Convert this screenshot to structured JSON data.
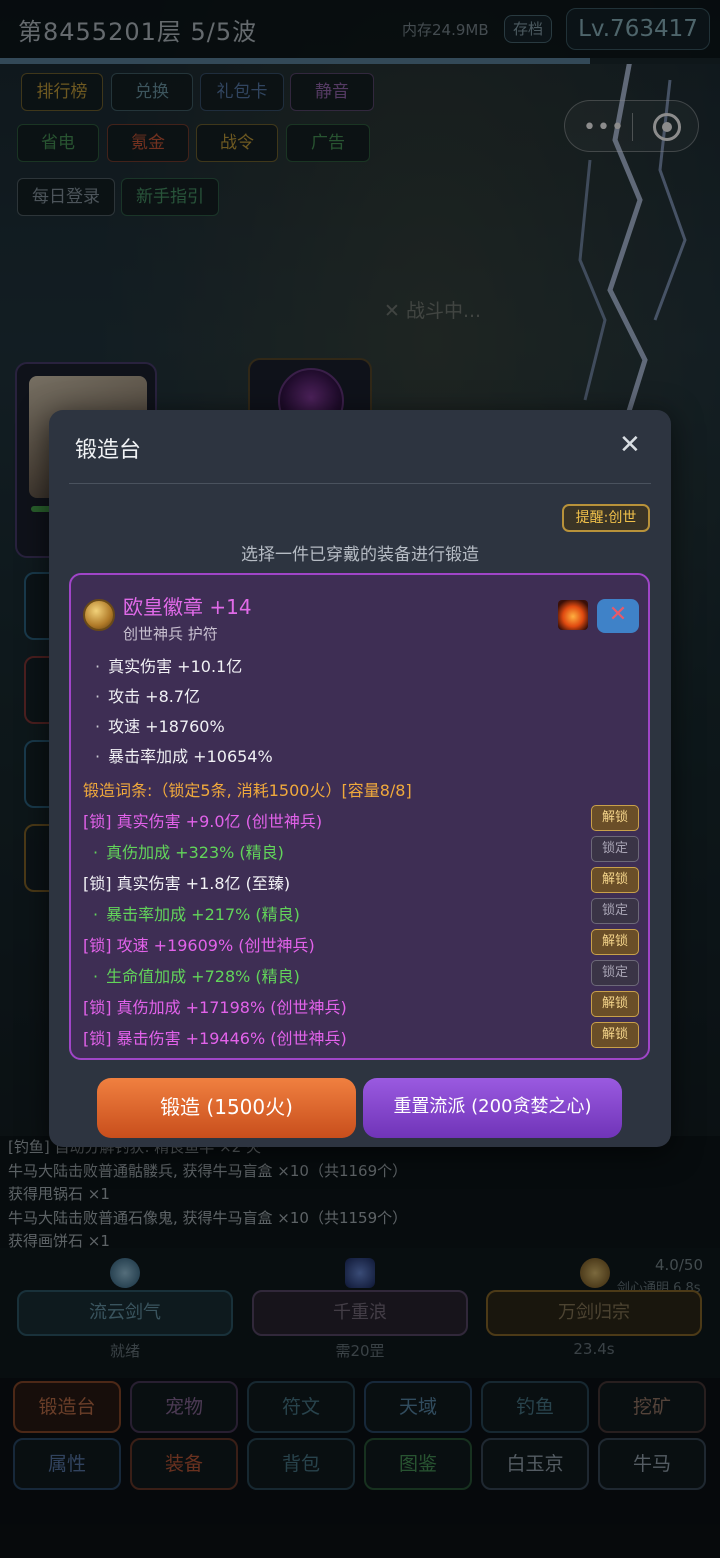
{
  "header": {
    "floor_title": "第8455201层  5/5波",
    "memory": "内存24.9MB",
    "save_label": "存档",
    "level": "Lv.763417",
    "wave_progress": 0.82
  },
  "menu_buttons": [
    {
      "label": "排行榜",
      "color": "#c9a23c"
    },
    {
      "label": "兑换",
      "color": "#6d9aa8"
    },
    {
      "label": "礼包卡",
      "color": "#5a7fb0"
    },
    {
      "label": "静音",
      "color": "#9a6ab4"
    },
    {
      "label": "省电",
      "color": "#4a9a5a"
    },
    {
      "label": "氪金",
      "color": "#d05a3a"
    },
    {
      "label": "战令",
      "color": "#c9a23c"
    },
    {
      "label": "广告",
      "color": "#4a9a5a"
    },
    {
      "label": "每日登录",
      "color": "#8a9aa4"
    },
    {
      "label": "新手指引",
      "color": "#4a9a6a"
    }
  ],
  "scene": {
    "battle_status": "✕ 战斗中..."
  },
  "modal": {
    "title": "锻造台",
    "reminder": "提醒:创世",
    "hint": "选择一件已穿戴的装备进行锻造",
    "item": {
      "name": "欧皇徽章 +14",
      "subtitle": "创世神兵 护符",
      "stats": [
        "真实伤害 +10.1亿",
        "攻击 +8.7亿",
        "攻速 +18760%",
        "暴击率加成 +10654%"
      ]
    },
    "affix_header": "锻造词条:（锁定5条, 消耗1500火）[容量8/8]",
    "affixes": [
      {
        "text": "[锁] 真实伤害 +9.0亿 (创世神兵)",
        "style": "magenta",
        "action": "解锁"
      },
      {
        "text": "真伤加成 +323% (精良)",
        "style": "green",
        "action": "锁定"
      },
      {
        "text": "[锁] 真实伤害 +1.8亿 (至臻)",
        "style": "white",
        "action": "解锁"
      },
      {
        "text": "暴击率加成 +217% (精良)",
        "style": "green",
        "action": "锁定"
      },
      {
        "text": "[锁] 攻速 +19609% (创世神兵)",
        "style": "magenta",
        "action": "解锁"
      },
      {
        "text": "生命值加成 +728% (精良)",
        "style": "green",
        "action": "锁定"
      },
      {
        "text": "[锁] 真伤加成 +17198% (创世神兵)",
        "style": "magenta",
        "action": "解锁"
      },
      {
        "text": "[锁] 暴击伤害 +19446% (创世神兵)",
        "style": "magenta",
        "action": "解锁"
      }
    ],
    "forge_label": "锻造 (1500火)",
    "reset_label": "重置流派 (200贪婪之心)"
  },
  "log": {
    "lines": [
      "[钓鱼] 自动分解钓获: 精良鱼竿 ×2 火",
      "牛马大陆击败普通骷髅兵, 获得牛马盲盒 ×10（共1169个）",
      "获得甩锅石 ×1",
      "牛马大陆击败普通石像鬼, 获得牛马盲盒 ×10（共1159个）",
      "获得画饼石 ×1"
    ]
  },
  "skills": {
    "counter": "4.0/50",
    "counter_sub": "剑心通明 6.8s",
    "items": [
      {
        "label": "流云剑气",
        "status": "就绪"
      },
      {
        "label": "千重浪",
        "status": "需20罡"
      },
      {
        "label": "万剑归宗",
        "status": "23.4s"
      }
    ]
  },
  "tabs": {
    "row1": [
      "锻造台",
      "宠物",
      "符文",
      "天域",
      "钓鱼",
      "挖矿"
    ],
    "row2": [
      "属性",
      "装备",
      "背包",
      "图鉴",
      "白玉京",
      "牛马"
    ]
  }
}
